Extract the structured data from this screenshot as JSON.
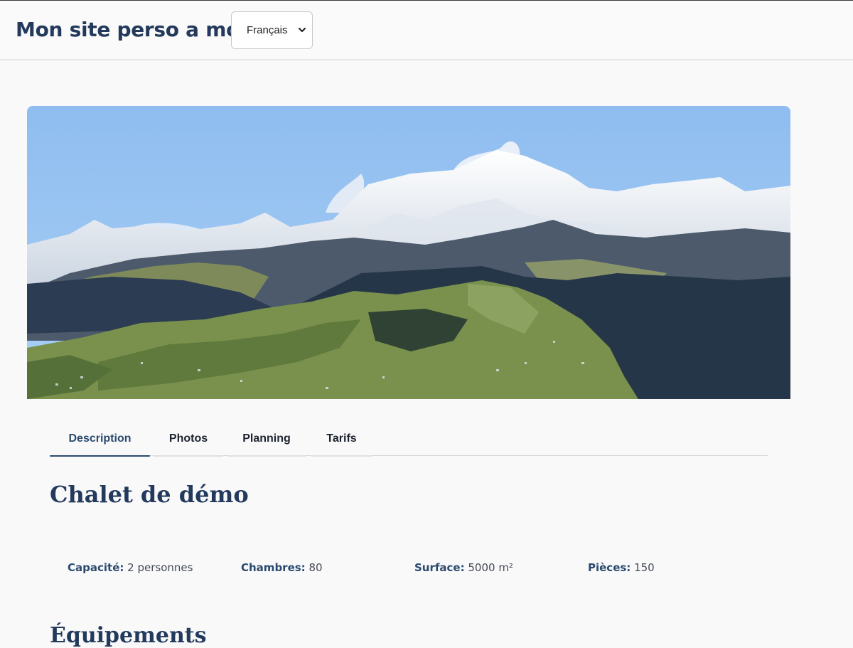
{
  "header": {
    "site_title": "Mon site perso a moi",
    "language_select": {
      "selected": "Français"
    }
  },
  "hero": {
    "alt": "Mountain landscape"
  },
  "tabs": [
    {
      "label": "Description",
      "active": true
    },
    {
      "label": "Photos",
      "active": false
    },
    {
      "label": "Planning",
      "active": false
    },
    {
      "label": "Tarifs",
      "active": false
    }
  ],
  "main": {
    "title": "Chalet de démo",
    "specs": [
      {
        "label": "Capacité:",
        "value": "2 personnes"
      },
      {
        "label": "Chambres:",
        "value": "80"
      },
      {
        "label": "Surface:",
        "value": "5000 m²"
      },
      {
        "label": "Pièces:",
        "value": "150"
      }
    ],
    "equipment_title": "Équipements"
  },
  "colors": {
    "brand": "#233a5c",
    "accent": "#2b4a6e",
    "background": "#f9f9fa"
  },
  "icons": {
    "select_chevron": "chevron-down-icon"
  }
}
